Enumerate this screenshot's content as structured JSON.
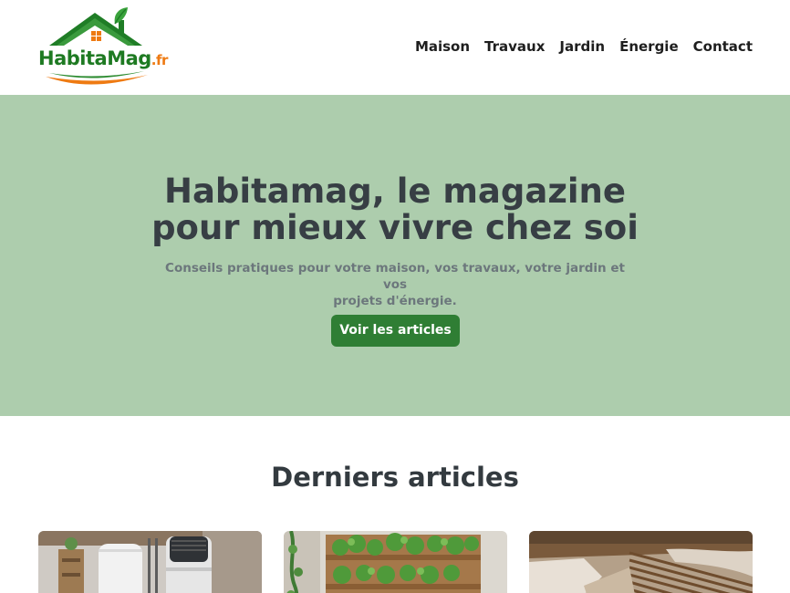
{
  "header": {
    "logo": {
      "part1": "Habita",
      "part2": "Mag",
      "part3": ".fr",
      "house_icon": "house-roof-icon",
      "leaf_icon": "leaf-icon"
    },
    "nav": [
      {
        "label": "Maison"
      },
      {
        "label": "Travaux"
      },
      {
        "label": "Jardin"
      },
      {
        "label": "Énergie"
      },
      {
        "label": "Contact"
      }
    ]
  },
  "hero": {
    "title_line1": "Habitamag, le magazine",
    "title_line2": "pour mieux vivre chez soi",
    "subtitle_line1": "Conseils pratiques pour votre maison, vos travaux, votre jardin et vos",
    "subtitle_line2": "projets d'énergie.",
    "cta_label": "Voir les articles"
  },
  "articles": {
    "heading": "Derniers articles",
    "cards": [
      {
        "image": "water-heater-photo"
      },
      {
        "image": "vertical-garden-photo"
      },
      {
        "image": "renovation-wall-photo"
      }
    ]
  },
  "colors": {
    "hero_bg": "#adcdad",
    "button_bg": "#2f7e34",
    "brand_green": "#1e7a22",
    "brand_orange": "#ee7a12"
  }
}
